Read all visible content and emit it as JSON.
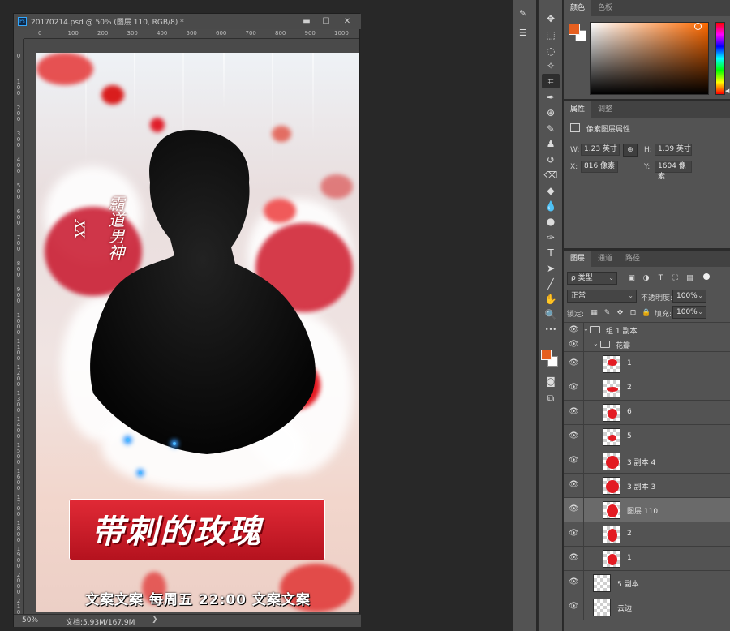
{
  "document": {
    "title": "20170214.psd @ 50% (图层 110, RGB/8) *",
    "ps_badge": "Ps",
    "minimize": "▬",
    "maximize": "☐",
    "close": "✕",
    "ruler_h": [
      "0",
      "100",
      "200",
      "300",
      "400",
      "500",
      "600",
      "700",
      "800",
      "900",
      "1000"
    ],
    "ruler_v": [
      "0",
      "1\n0\n0",
      "2\n0\n0",
      "3\n0\n0",
      "4\n0\n0",
      "5\n0\n0",
      "6\n0\n0",
      "7\n0\n0",
      "8\n0\n0",
      "9\n0\n0",
      "1\n0\n0\n0",
      "1\n1\n0\n0",
      "1\n2\n0\n0",
      "1\n3\n0\n0",
      "1\n4\n0\n0",
      "1\n5\n0\n0",
      "1\n6\n0\n0",
      "1\n7\n0\n0",
      "1\n8\n0\n0",
      "1\n9\n0\n0",
      "2\n0\n0\n0",
      "2\n1\n0\n0"
    ],
    "zoom": "50%",
    "doc_size": "文档:5.93M/167.9M",
    "status_arrow": "❯"
  },
  "poster": {
    "vertical_title": "霸道男神",
    "vertical_small": "XX",
    "banner_title": "带刺的玫瑰",
    "slogan": "文案文案  每周五  22:00  文案文案"
  },
  "tools": [
    {
      "icon": "move-tool-icon",
      "glyph": "✥"
    },
    {
      "icon": "marquee-tool-icon",
      "glyph": "⬚"
    },
    {
      "icon": "lasso-tool-icon",
      "glyph": "◌"
    },
    {
      "icon": "magic-wand-tool-icon",
      "glyph": "✧"
    },
    {
      "icon": "crop-tool-icon",
      "glyph": "⌗"
    },
    {
      "icon": "eyedropper-tool-icon",
      "glyph": "✒"
    },
    {
      "icon": "spot-healing-tool-icon",
      "glyph": "⊕"
    },
    {
      "icon": "brush-tool-icon",
      "glyph": "✎"
    },
    {
      "icon": "clone-stamp-tool-icon",
      "glyph": "♟"
    },
    {
      "icon": "history-brush-tool-icon",
      "glyph": "↺"
    },
    {
      "icon": "eraser-tool-icon",
      "glyph": "⌫"
    },
    {
      "icon": "paint-bucket-tool-icon",
      "glyph": "◆"
    },
    {
      "icon": "blur-tool-icon",
      "glyph": "💧"
    },
    {
      "icon": "dodge-tool-icon",
      "glyph": "●"
    },
    {
      "icon": "pen-tool-icon",
      "glyph": "✑"
    },
    {
      "icon": "type-tool-icon",
      "glyph": "T"
    },
    {
      "icon": "path-selection-tool-icon",
      "glyph": "➤"
    },
    {
      "icon": "line-tool-icon",
      "glyph": "╱"
    },
    {
      "icon": "hand-tool-icon",
      "glyph": "✋"
    },
    {
      "icon": "zoom-tool-icon",
      "glyph": "🔍"
    },
    {
      "icon": "more-tools-icon",
      "glyph": "•••"
    }
  ],
  "colors": {
    "foreground": "#e65f1f",
    "background": "#ffffff"
  },
  "color_panel": {
    "tab_color": "颜色",
    "tab_swatches": "色板"
  },
  "properties": {
    "tab_properties": "属性",
    "tab_adjustments": "调整",
    "title": "像素图层属性",
    "w_label": "W:",
    "w_value": "1.23 英寸",
    "h_label": "H:",
    "h_value": "1.39 英寸",
    "x_label": "X:",
    "x_value": "816 像素",
    "y_label": "Y:",
    "y_value": "1604 像素",
    "link": "⊕"
  },
  "layers_panel": {
    "tab_layers": "图层",
    "tab_channels": "通道",
    "tab_paths": "路径",
    "filter_kind": "ρ 类型",
    "blend_mode": "正常",
    "opacity_label": "不透明度:",
    "opacity_value": "100%",
    "lock_label": "锁定:",
    "fill_label": "填充:",
    "fill_value": "100%",
    "group_name": "组 1 副本",
    "subgroup_name": "花瓣",
    "layers": [
      {
        "name": "1",
        "selected": false
      },
      {
        "name": "2",
        "selected": false
      },
      {
        "name": "6",
        "selected": false
      },
      {
        "name": "5",
        "selected": false
      },
      {
        "name": "3 副本 4",
        "selected": false
      },
      {
        "name": "3 副本 3",
        "selected": false
      },
      {
        "name": "图层 110",
        "selected": true
      },
      {
        "name": "2",
        "selected": false
      },
      {
        "name": "1",
        "selected": false
      },
      {
        "name": "5 副本",
        "selected": false
      },
      {
        "name": "云边",
        "selected": false
      }
    ]
  }
}
